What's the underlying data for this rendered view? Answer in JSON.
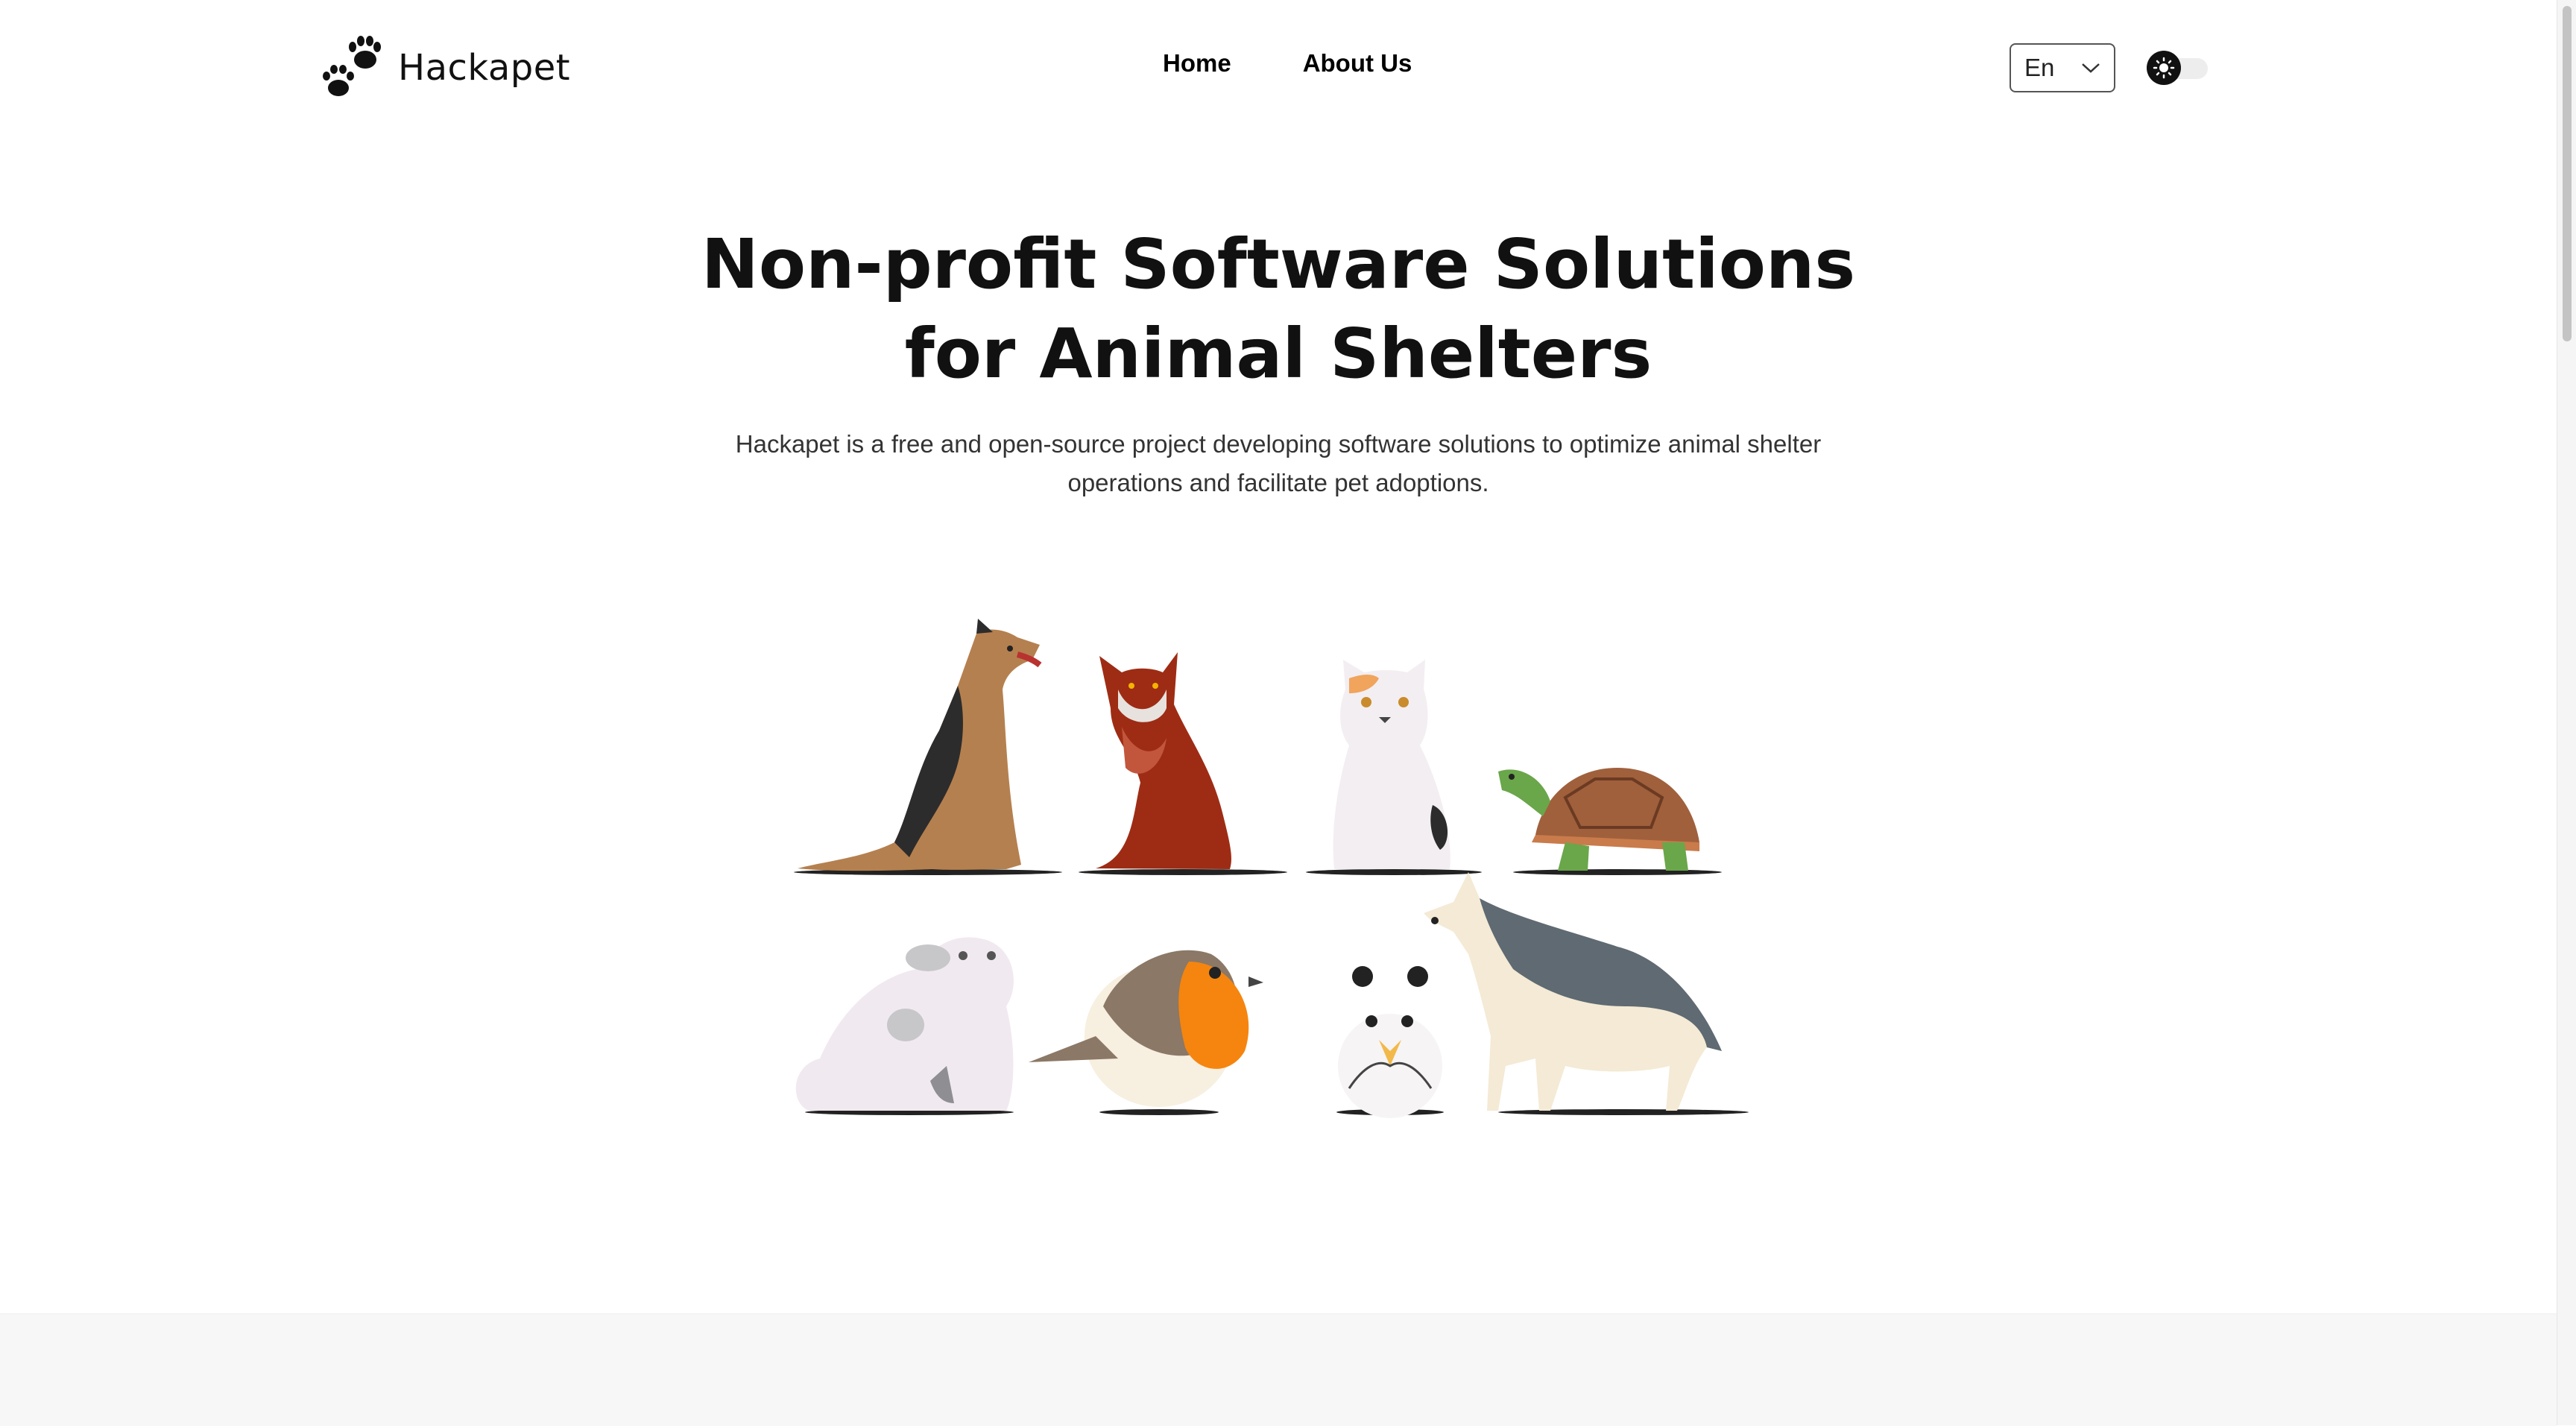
{
  "header": {
    "logo_text": "Hackapet",
    "logo_icon": "paw-icon",
    "nav": {
      "home": "Home",
      "about": "About Us"
    },
    "language": {
      "selected": "En",
      "icon": "chevron-down-icon"
    },
    "theme_toggle": {
      "icon": "sun-icon",
      "state": "light"
    }
  },
  "hero": {
    "title": "Non-profit Software Solutions for Animal Shelters",
    "subtitle": "Hackapet is a free and open-source project developing software solutions to optimize animal shelter operations and facilitate pet adoptions."
  },
  "illustration": {
    "animals": [
      "german-shepherd",
      "red-cat",
      "white-cat",
      "turtle",
      "persian-cat",
      "robin-bird",
      "hamster",
      "husky"
    ]
  },
  "colors": {
    "text": "#111111",
    "dog_brown": "#b5804f",
    "cat_red": "#9e2c14",
    "turtle_shell": "#a0603c",
    "turtle_skin": "#6aa64a",
    "robin_orange": "#f5850f",
    "husky_gray": "#5f6a72"
  }
}
